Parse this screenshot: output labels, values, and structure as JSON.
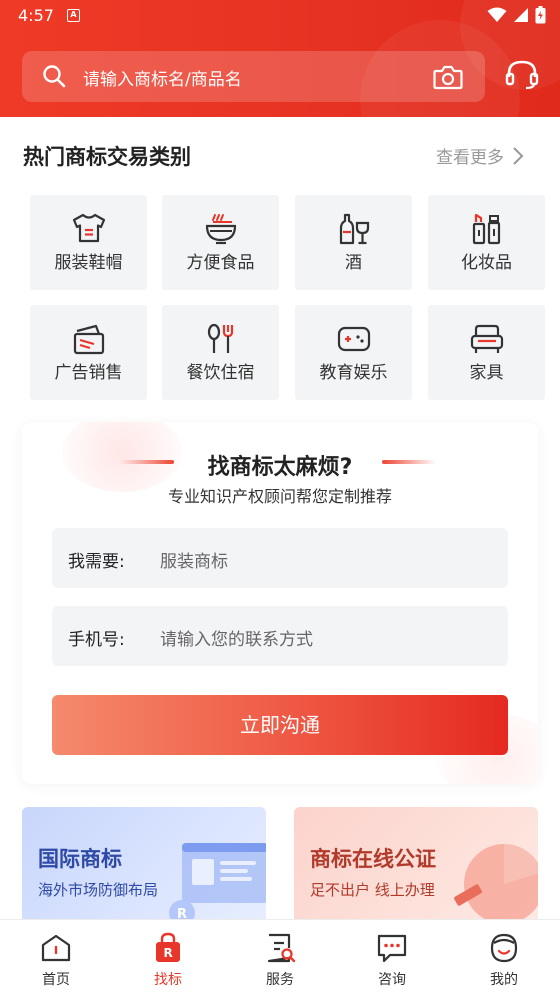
{
  "status_bar": {
    "time": "4:57",
    "notification_badge": "A"
  },
  "search": {
    "placeholder": "请输入商标名/商品名"
  },
  "hot_section": {
    "title": "热门商标交易类别",
    "more_label": "查看更多",
    "categories": [
      {
        "label": "服装鞋帽",
        "icon": "tshirt-icon"
      },
      {
        "label": "方便食品",
        "icon": "noodle-bowl-icon"
      },
      {
        "label": "酒",
        "icon": "wine-icon"
      },
      {
        "label": "化妆品",
        "icon": "cosmetics-icon"
      },
      {
        "label": "广告销售",
        "icon": "ad-card-icon"
      },
      {
        "label": "餐饮住宿",
        "icon": "spoon-fork-icon"
      },
      {
        "label": "教育娱乐",
        "icon": "gamepad-icon"
      },
      {
        "label": "家具",
        "icon": "sofa-icon"
      }
    ]
  },
  "form": {
    "title": "找商标太麻烦?",
    "subtitle": "专业知识产权顾问帮您定制推荐",
    "need_label": "我需要:",
    "need_value": "服装商标",
    "phone_label": "手机号:",
    "phone_placeholder": "请输入您的联系方式",
    "submit_label": "立即沟通"
  },
  "promos": [
    {
      "title": "国际商标",
      "subtitle": "海外市场防御布局"
    },
    {
      "title": "商标在线公证",
      "subtitle": "足不出户 线上办理"
    }
  ],
  "bottom_nav": [
    {
      "label": "首页",
      "icon": "home-icon",
      "active": false
    },
    {
      "label": "找标",
      "icon": "shopping-bag-icon",
      "active": true
    },
    {
      "label": "服务",
      "icon": "document-search-icon",
      "active": false
    },
    {
      "label": "咨询",
      "icon": "chat-bubble-icon",
      "active": false
    },
    {
      "label": "我的",
      "icon": "user-face-icon",
      "active": false
    }
  ],
  "colors": {
    "brand_red": "#e8372a",
    "header_red": "#ea3523",
    "promo_blue": "#2f4aa6"
  }
}
